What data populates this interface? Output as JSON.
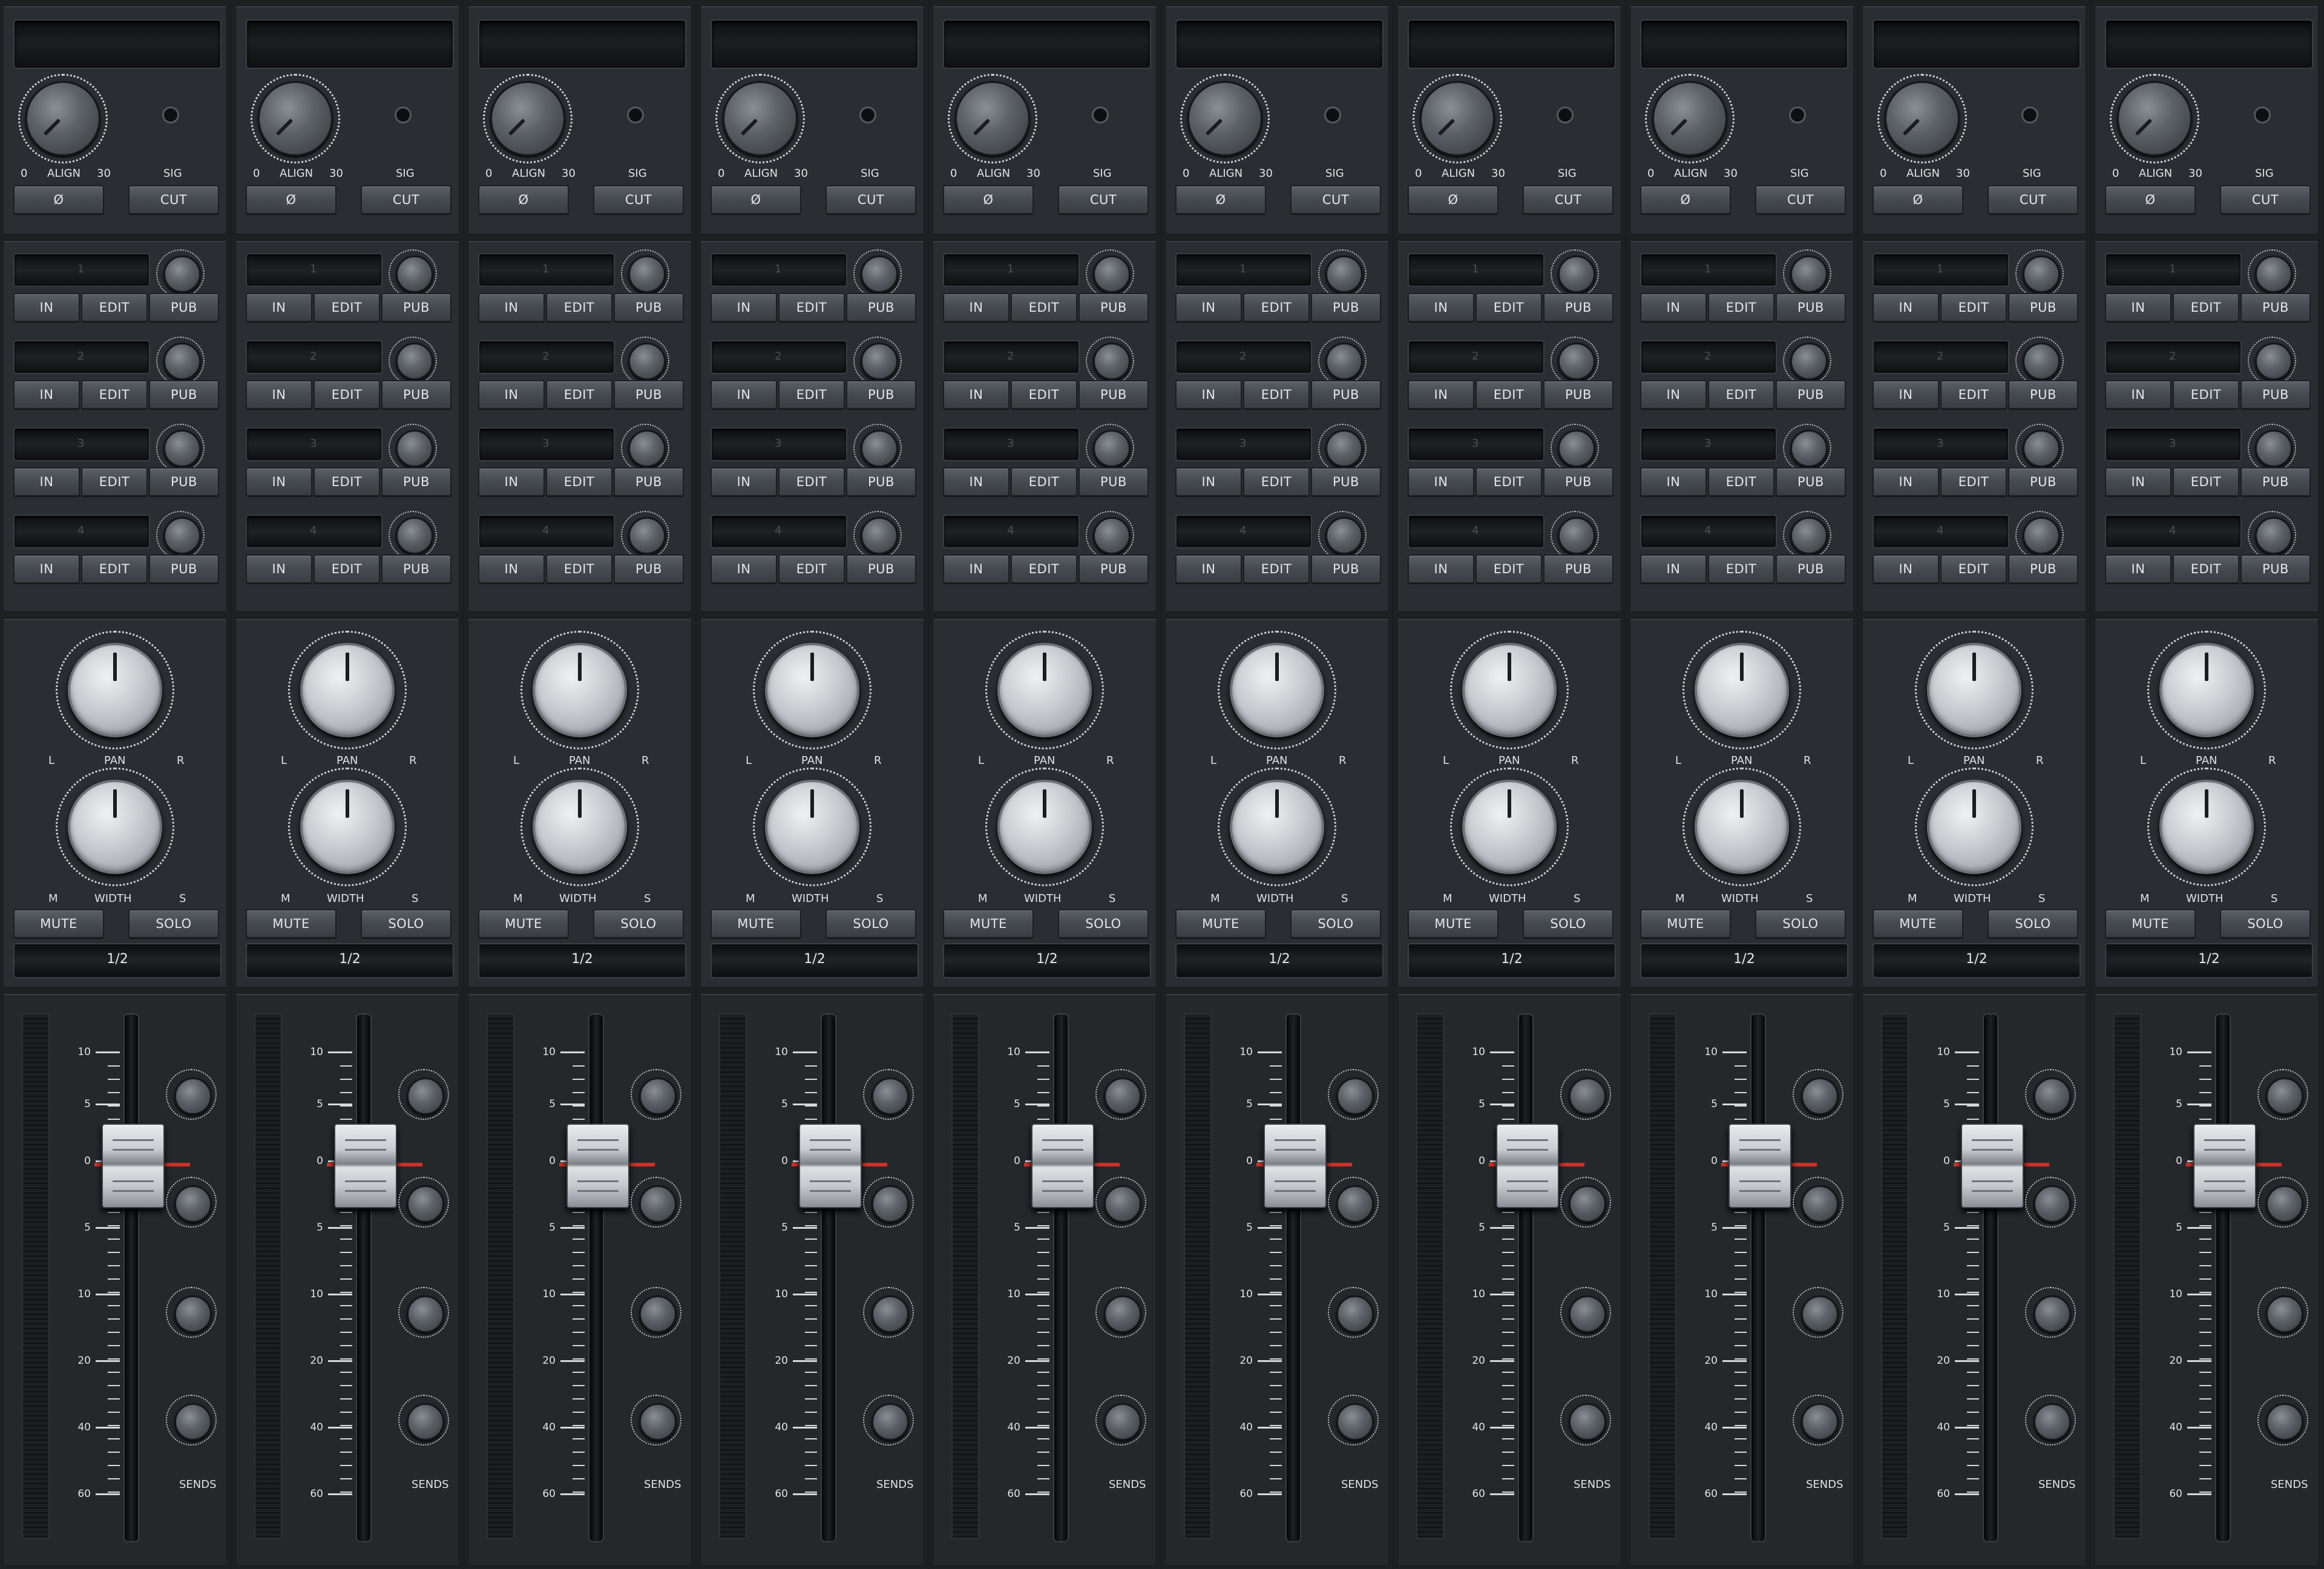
{
  "colors": {
    "accent_red": "#c9332a",
    "panel": "#2a2d31",
    "button": "#4a4f55",
    "text": "#e4e6ea"
  },
  "channel_count": 10,
  "input_section": {
    "display": "",
    "align_label": "ALIGN",
    "align_min": "0",
    "align_max": "30",
    "sig_label": "SIG",
    "phase_button": "Ø",
    "cut_button": "CUT"
  },
  "insert_section": {
    "slots": [
      {
        "number": "1",
        "in": "IN",
        "edit": "EDIT",
        "pub": "PUB"
      },
      {
        "number": "2",
        "in": "IN",
        "edit": "EDIT",
        "pub": "PUB"
      },
      {
        "number": "3",
        "in": "IN",
        "edit": "EDIT",
        "pub": "PUB"
      },
      {
        "number": "4",
        "in": "IN",
        "edit": "EDIT",
        "pub": "PUB"
      }
    ]
  },
  "pan_section": {
    "pan_label": "PAN",
    "pan_left": "L",
    "pan_right": "R",
    "width_label": "WIDTH",
    "width_left": "M",
    "width_right": "S",
    "mute_button": "MUTE",
    "solo_button": "SOLO",
    "routing": "1/2"
  },
  "fader_section": {
    "scale": [
      "10",
      "5",
      "0",
      "5",
      "10",
      "20",
      "40",
      "60"
    ],
    "sends_label": "SENDS",
    "fader_level_db": 0
  }
}
